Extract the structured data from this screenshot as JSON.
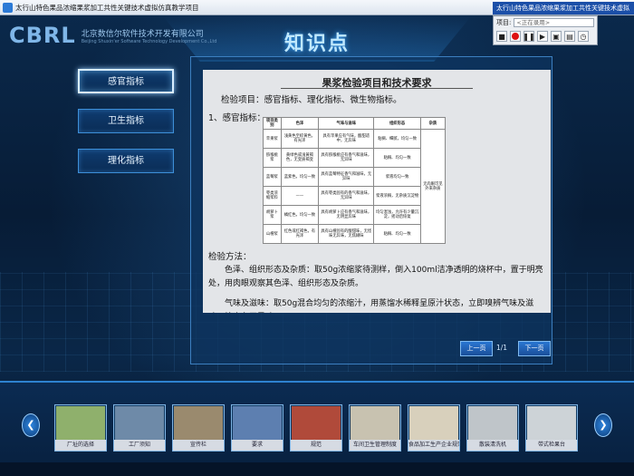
{
  "window": {
    "title": "太行山特色果品浓缩果浆加工共性关键技术虚拟仿真教学项目"
  },
  "recorder": {
    "title": "太行山特色果品浓缩果浆加工共性关键技术虚拟",
    "project_label": "项目:",
    "project_select": "<正在录用>"
  },
  "header": {
    "logo_mark": "CBRL",
    "company_cn": "北京数信尔软件技术开发有限公司",
    "company_en": "Beijing Shuxin'er Software Technology Development Co.,Ltd",
    "page_title": "知识点"
  },
  "menu": [
    {
      "label": "感官指标",
      "active": true
    },
    {
      "label": "卫生指标",
      "active": false
    },
    {
      "label": "理化指标",
      "active": false
    }
  ],
  "doc": {
    "title": "果浆检验项目和技术要求",
    "line1": "检验项目：感官指标、理化指标、微生物指标。",
    "line2": "1、感官指标：",
    "table": {
      "headers": [
        "项目类别",
        "色泽",
        "气味与滋味",
        "组织形态",
        "杂质"
      ],
      "rows": [
        [
          "苹果浆",
          "浅黄色至棕黄色，有光泽",
          "具有苹果应有气味，酸甜适中，无异味",
          "粘稠、细腻，均匀一致",
          "无肉眼可见外来杂质"
        ],
        [
          "猕猴桃浆",
          "黄绿色或浅黄褐色，无变质褐变",
          "具有猕猴桃应有香气和滋味，无异味",
          "粘稠、均匀一致",
          ""
        ],
        [
          "蓝莓浆",
          "蓝紫色，均匀一致",
          "具有蓝莓特征香气和滋味，无异味",
          "浆液均匀一致",
          ""
        ],
        [
          "枣类浓缩浆料",
          "——",
          "具有枣类固有的香气和滋味，无异味",
          "浆液浓稠，无杂质沉淀物",
          ""
        ],
        [
          "胡萝卜浆",
          "橘红色，均匀一致",
          "具有胡萝卜应有香气和滋味，无明显异味",
          "均匀混浊，允许有少量沉淀，摇动后恢复",
          ""
        ],
        [
          "山楂浆",
          "红色或红褐色，有光泽",
          "具有山楂固有的酸甜味，无怪味无异味，无焦糊味",
          "粘稠、均匀一致",
          ""
        ]
      ]
    },
    "section": "检验方法：",
    "para1": "色泽、组织形态及杂质：取50g浓缩浆待测样，倒入100ml洁净透明的烧杯中，置于明亮处，用肉眼观察其色泽、组织形态及杂质。",
    "para2": "气味及滋味：取50g混合均匀的浓缩汁，用蒸馏水稀释呈原汁状态，立即嗅辨气味及滋味，检查有无异味"
  },
  "pager": {
    "prev": "上一页",
    "info": "1/1",
    "next": "下一页"
  },
  "thumbnails": [
    {
      "label": "厂址的选择",
      "color": "#8fb06c"
    },
    {
      "label": "工厂须知",
      "color": "#6e8aa8"
    },
    {
      "label": "宣传栏",
      "color": "#9a8a6e"
    },
    {
      "label": "要求",
      "color": "#5d7fb0"
    },
    {
      "label": "规范",
      "color": "#b04a3a"
    },
    {
      "label": "车间卫生管理制度",
      "color": "#c8c2b0"
    },
    {
      "label": "食品加工生产企业规范",
      "color": "#d8d0bc"
    },
    {
      "label": "散装清洗机",
      "color": "#bfc5c9"
    },
    {
      "label": "带式检果台",
      "color": "#cdd3d7"
    }
  ]
}
